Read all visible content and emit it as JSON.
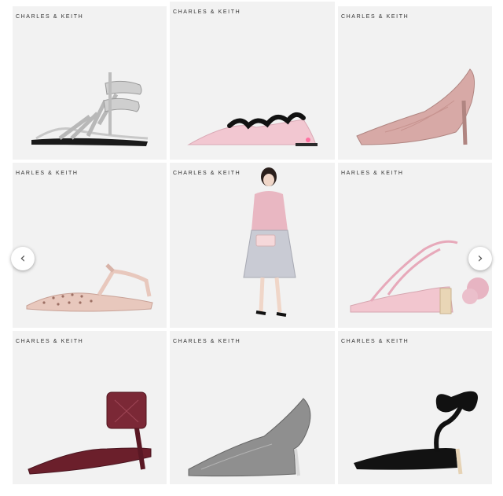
{
  "gallery": {
    "products": [
      {
        "brand": "CHARLES & KEITH",
        "item": "silver-gladiator-sandal"
      },
      {
        "brand": "CHARLES & KEITH",
        "item": "pink-ruffle-slide"
      },
      {
        "brand": "CHARLES & KEITH",
        "item": "rose-lace-pump"
      },
      {
        "brand": "HARLES & KEITH",
        "item": "studded-pointed-flat-sandal"
      },
      {
        "brand": "CHARLES & KEITH",
        "item": "model-pink-blouse-silver-skirt"
      },
      {
        "brand": "HARLES & KEITH",
        "item": "pink-lace-up-block-heel-sandal"
      },
      {
        "brand": "CHARLES & KEITH",
        "item": "burgundy-lace-cuff-kitten-heel"
      },
      {
        "brand": "CHARLES & KEITH",
        "item": "glitter-pump"
      },
      {
        "brand": "CHARLES & KEITH",
        "item": "black-bow-heel-sandal"
      }
    ]
  },
  "nav": {
    "prev_icon": "chevron-left-icon",
    "next_icon": "chevron-right-icon",
    "prev_glyph": "‹",
    "next_glyph": "›"
  },
  "colors": {
    "tile_background": "#f2f2f2",
    "page_background": "#ffffff"
  }
}
